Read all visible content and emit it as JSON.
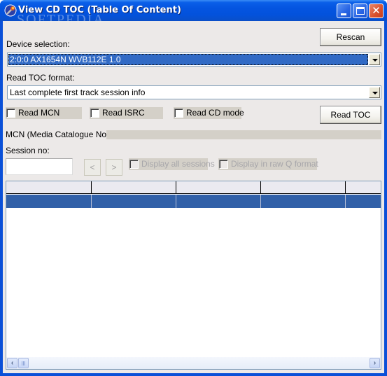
{
  "window": {
    "title": "View CD TOC (Table Of Content)",
    "watermark": "SOFTPEDIA",
    "watermark_url": "www.softpedia.com",
    "controls": {
      "minimize": "minimize",
      "maximize": "maximize",
      "close": "✕"
    }
  },
  "toolbar": {
    "rescan_label": "Rescan",
    "read_toc_label": "Read TOC"
  },
  "device": {
    "label": "Device selection:",
    "selected": "2:0:0 AX1654N WVB112E 1.0"
  },
  "format": {
    "label": "Read TOC format:",
    "selected": "Last complete first track session info"
  },
  "options": {
    "read_mcn": {
      "label": "Read MCN",
      "checked": false
    },
    "read_isrc": {
      "label": "Read ISRC",
      "checked": false
    },
    "read_cd_mode": {
      "label": "Read CD mode",
      "checked": false
    }
  },
  "mcn": {
    "label": "MCN (Media Catalogue No.) :",
    "value": ""
  },
  "session": {
    "label": "Session no:",
    "value": "",
    "prev_label": "<",
    "next_label": ">",
    "display_all_label": "Display all sessions",
    "display_raw_label": "Display in raw Q format"
  },
  "table": {
    "columns": [
      "",
      "",
      "",
      "",
      ""
    ],
    "rows": [
      [
        "",
        "",
        "",
        "",
        ""
      ]
    ]
  },
  "scrollbar": {
    "left_arrow": "‹",
    "right_arrow": "›"
  }
}
